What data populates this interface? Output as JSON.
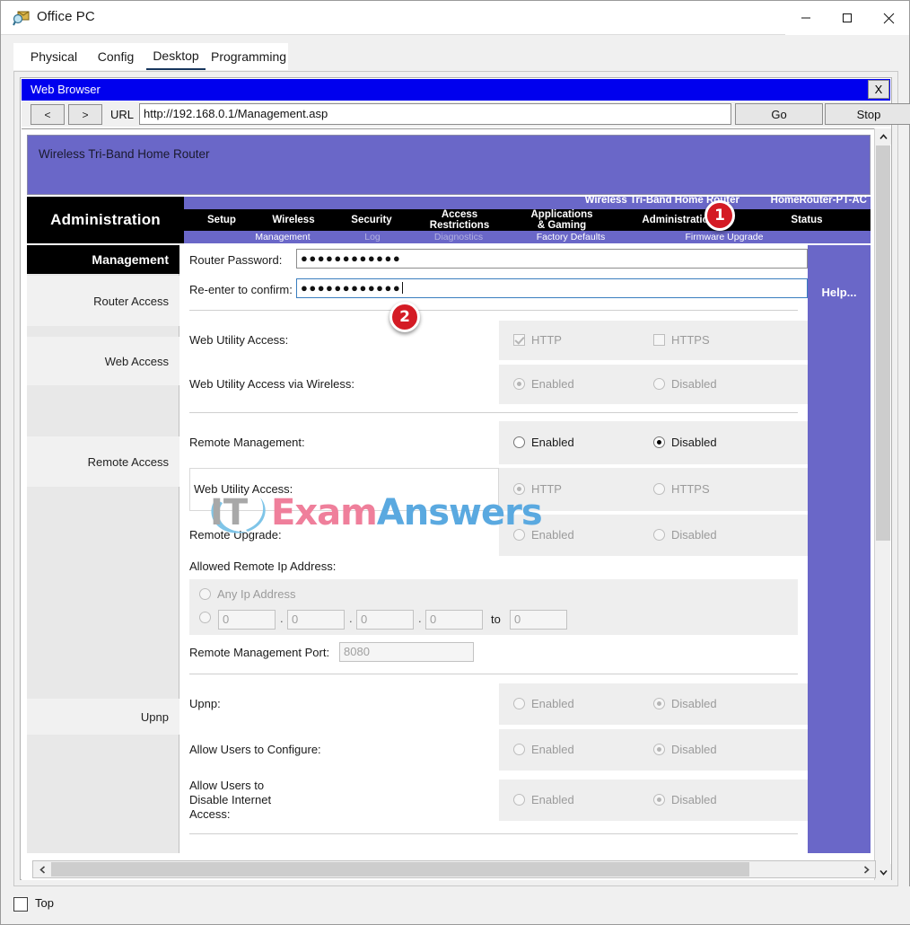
{
  "window": {
    "title": "Office PC",
    "icon": "packet-tracer-pc-icon",
    "minimize": "—",
    "maximize": "□",
    "close": "✕"
  },
  "tabs": [
    {
      "label": "Physical",
      "active": false
    },
    {
      "label": "Config",
      "active": false
    },
    {
      "label": "Desktop",
      "active": true
    },
    {
      "label": "Programming",
      "active": false
    }
  ],
  "browser": {
    "title": "Web Browser",
    "close_label": "X",
    "back_label": "<",
    "forward_label": ">",
    "url_label": "URL",
    "url_value": "http://192.168.0.1/Management.asp",
    "go_label": "Go",
    "stop_label": "Stop"
  },
  "router": {
    "banner_text": "Wireless Tri-Band Home Router",
    "section_title": "Administration",
    "header_name": "Wireless Tri-Band Home Router",
    "header_model": "HomeRouter-PT-AC",
    "nav": [
      {
        "label": "Setup"
      },
      {
        "label": "Wireless"
      },
      {
        "label": "Security"
      },
      {
        "label": "Access Restrictions",
        "line1": "Access",
        "line2": "Restrictions"
      },
      {
        "label": "Applications & Gaming",
        "line1": "Applications",
        "line2": "& Gaming"
      },
      {
        "label": "Administration"
      },
      {
        "label": "Status"
      }
    ],
    "subnav": [
      {
        "label": "Management",
        "active": true
      },
      {
        "label": "Log",
        "active": false
      },
      {
        "label": "Diagnostics",
        "active": false
      },
      {
        "label": "Factory Defaults",
        "active": false
      },
      {
        "label": "Firmware Upgrade",
        "active": false
      }
    ],
    "help_label": "Help...",
    "sidebar": {
      "header": "Management",
      "items": [
        {
          "label": "Router Access"
        },
        {
          "label": "Web Access"
        },
        {
          "label": "Remote Access"
        },
        {
          "label": "Upnp"
        }
      ]
    },
    "form": {
      "router_password_label": "Router Password:",
      "router_password_value": "●●●●●●●●●●●●",
      "reenter_label": "Re-enter to confirm:",
      "reenter_value": "●●●●●●●●●●●●",
      "web_utility_access_label": "Web Utility Access:",
      "http_label": "HTTP",
      "https_label": "HTTPS",
      "web_utility_wireless_label": "Web Utility Access via Wireless:",
      "enabled_label": "Enabled",
      "disabled_label": "Disabled",
      "remote_management_label": "Remote Management:",
      "remote_web_utility_label": "Web Utility Access:",
      "remote_upgrade_label": "Remote Upgrade:",
      "allowed_remote_ip_label": "Allowed Remote Ip Address:",
      "any_ip_label": "Any Ip Address",
      "ip_octets": [
        "0",
        "0",
        "0",
        "0"
      ],
      "to_label": "to",
      "ip_range_end": "0",
      "remote_port_label": "Remote Management Port:",
      "remote_port_value": "8080",
      "upnp_label": "Upnp:",
      "allow_users_configure_label": "Allow Users to Configure:",
      "allow_users_disable_label": "Allow Users to\nDisable Internet\nAccess:",
      "allow_users_disable_line1": "Allow Users to",
      "allow_users_disable_line2": "Disable Internet",
      "allow_users_disable_line3": "Access:"
    }
  },
  "watermark": {
    "it": "IT",
    "exam": "Exam",
    "answers": "Answers"
  },
  "callouts": [
    {
      "number": "1"
    },
    {
      "number": "2"
    }
  ],
  "footer": {
    "top_label": "Top"
  },
  "colors": {
    "router_purple": "#6a67c8",
    "browser_blue": "#0000ee",
    "badge_red": "#d41b24",
    "focus_blue": "#3a7ebf"
  }
}
